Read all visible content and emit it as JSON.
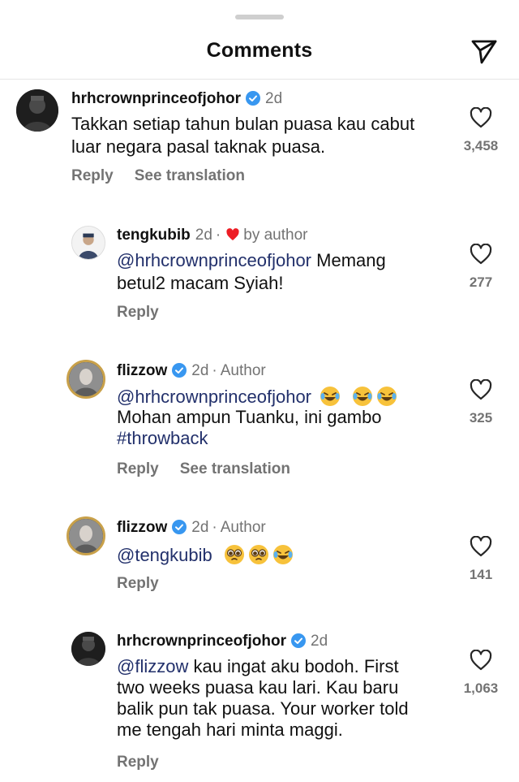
{
  "header": {
    "title": "Comments",
    "send_icon": "send-icon"
  },
  "colors": {
    "verified": "#3897f0",
    "heart": "#ed1c24",
    "muted": "#737373",
    "mention": "#22306b"
  },
  "labels": {
    "reply": "Reply",
    "see_translation": "See translation",
    "author": "Author",
    "by_author": "by author"
  },
  "comments": [
    {
      "username": "hrhcrownprinceofjohor",
      "verified": true,
      "time": "2d",
      "lines": [
        "Takkan setiap tahun bulan puasa kau cabut",
        "luar negara pasal taknak puasa."
      ],
      "likes": "3,458"
    },
    {
      "username": "tengkubib",
      "time": "2d",
      "liked_by_author": true,
      "mention": "@hrhcrownprinceofjohor",
      "line1_rest": " Memang",
      "line2": "betul2 macam Syiah!",
      "likes": "277"
    },
    {
      "username": "flizzow",
      "verified": true,
      "time": "2d",
      "mention": "@hrhcrownprinceofjohor",
      "line2": "Mohan ampun Tuanku, ini gambo",
      "hashtag": "#throwback",
      "emojis": [
        "laughing-tears-emoji",
        "laughing-tears-emoji",
        "laughing-tears-emoji"
      ],
      "likes": "325"
    },
    {
      "username": "flizzow",
      "verified": true,
      "time": "2d",
      "mention": "@tengkubib",
      "emojis": [
        "pleading-face-emoji",
        "pleading-face-emoji",
        "laughing-tears-emoji"
      ],
      "likes": "141"
    },
    {
      "username": "hrhcrownprinceofjohor",
      "verified": true,
      "time": "2d",
      "mention": "@flizzow",
      "line1_rest": " kau ingat aku bodoh. First",
      "lines_rest": [
        "two weeks puasa kau lari. Kau baru",
        "balik pun tak puasa. Your worker told",
        "me tengah hari minta maggi."
      ],
      "likes": "1,063"
    }
  ]
}
